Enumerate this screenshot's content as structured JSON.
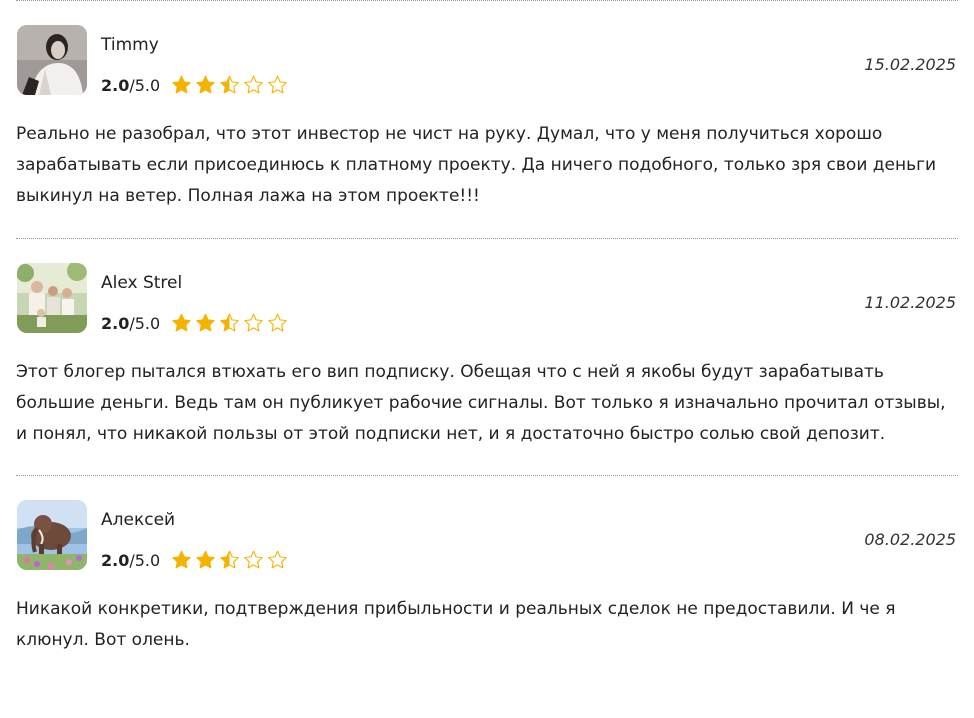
{
  "reviews": [
    {
      "author": "Timmy",
      "score": "2.0",
      "max": "/5.0",
      "rating": 2.5,
      "date": "15.02.2025",
      "avatar": "portrait-photo",
      "text": "Реально не разобрал, что этот инвестор не чист на руку. Думал, что у меня получиться хорошо зарабатывать если присоединюсь к платному проекту. Да ничего подобного, только зря свои деньги выкинул на ветер. Полная лажа на этом проекте!!!"
    },
    {
      "author": "Alex Strel",
      "score": "2.0",
      "max": "/5.0",
      "rating": 2.5,
      "date": "11.02.2025",
      "avatar": "family-photo",
      "text": "Этот блогер пытался втюхать его вип подписку. Обещая что с ней я якобы будут зарабатывать большие деньги. Ведь там он публикует рабочие сигналы. Вот только я изначально прочитал отзывы, и понял, что никакой пользы от этой подписки нет, и я достаточно быстро солью свой депозит."
    },
    {
      "author": "Алексей",
      "score": "2.0",
      "max": "/5.0",
      "rating": 2.5,
      "date": "08.02.2025",
      "avatar": "mammoth-photo",
      "text": "Никакой конкретики, подтверждения прибыльности и реальных сделок не предоставили. И че я клюнул. Вот олень."
    }
  ],
  "colors": {
    "star_fill": "#f5b301",
    "star_empty": "#f5b301",
    "divider": "#9a9a9a"
  },
  "icons": {
    "star_full": "star-full-icon",
    "star_half": "star-half-icon",
    "star_empty": "star-empty-icon"
  }
}
